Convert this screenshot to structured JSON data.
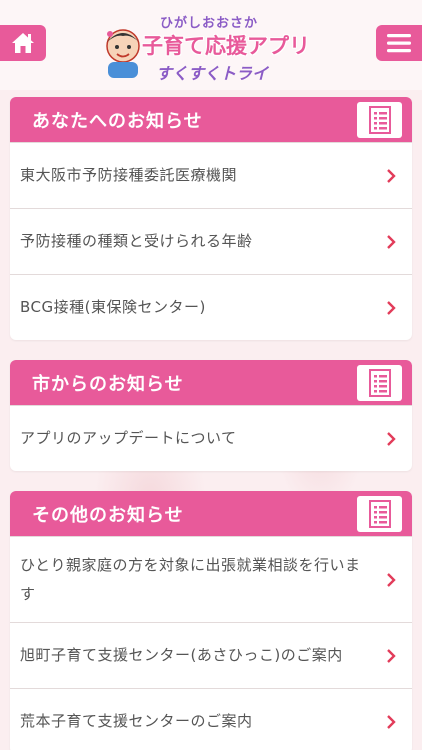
{
  "header": {
    "logo_sub": "ひがしおおさか",
    "logo_main": "子育て応援アプリ",
    "logo_tag": "すくすくトライ",
    "accent": "#e85a9a"
  },
  "sections": [
    {
      "title": "あなたへのお知らせ",
      "items": [
        {
          "label": "東大阪市予防接種委託医療機関"
        },
        {
          "label": "予防接種の種類と受けられる年齢"
        },
        {
          "label": "BCG接種(東保険センター)"
        }
      ]
    },
    {
      "title": "市からのお知らせ",
      "items": [
        {
          "label": "アプリのアップデートについて"
        }
      ]
    },
    {
      "title": "その他のお知らせ",
      "items": [
        {
          "label": "ひとり親家庭の方を対象に出張就業相談を行います"
        },
        {
          "label": "旭町子育て支援センター(あさひっこ)のご案内"
        },
        {
          "label": "荒本子育て支援センターのご案内"
        }
      ]
    }
  ],
  "icons": {
    "home": "home-icon",
    "menu": "hamburger-menu-icon",
    "list": "list-icon",
    "chevron": "chevron-right-icon"
  }
}
